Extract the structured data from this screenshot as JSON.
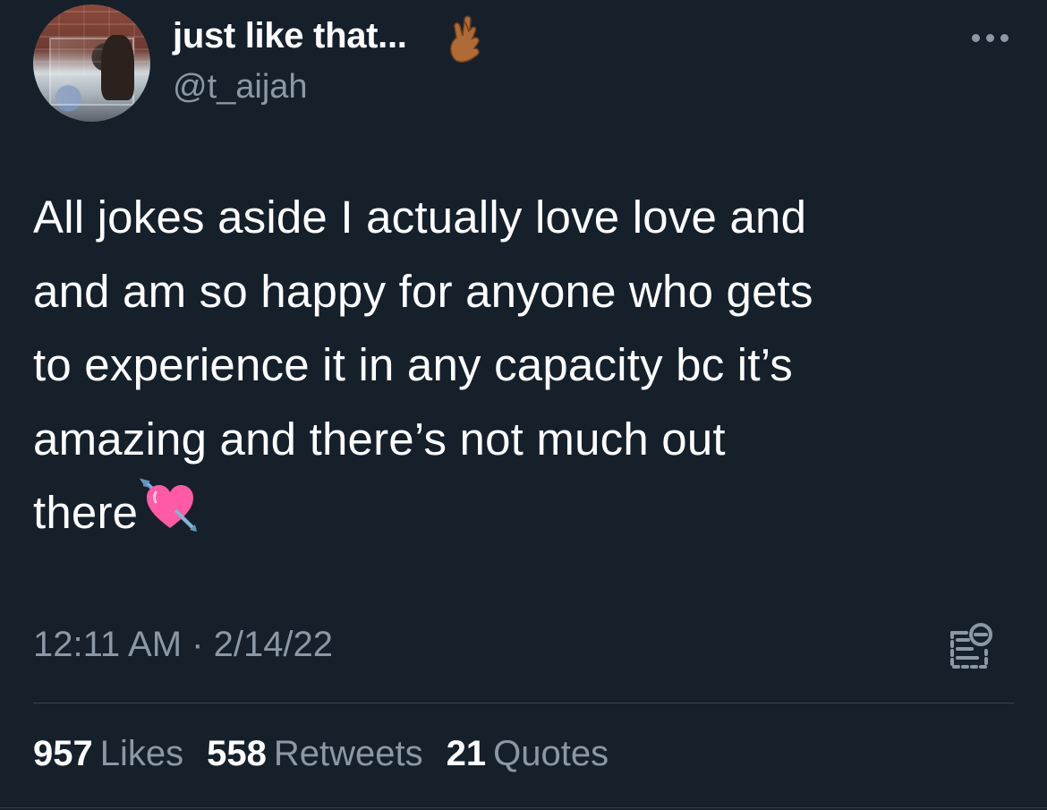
{
  "author": {
    "display_name": "just like that...",
    "handle": "@t_aijah",
    "display_name_emoji": "crossed-fingers-icon"
  },
  "tweet": {
    "lines": [
      "All jokes aside I actually love love and",
      "and am so happy for anyone who gets",
      "to experience it in any capacity bc it’s",
      "amazing and there’s not much out",
      "there"
    ],
    "trailing_emoji": "heart-with-arrow-icon",
    "timestamp": "12:11 AM · 2/14/22"
  },
  "stats": [
    {
      "count": "957",
      "label": "Likes"
    },
    {
      "count": "558",
      "label": "Retweets"
    },
    {
      "count": "21",
      "label": "Quotes"
    }
  ],
  "colors": {
    "background": "#15202b",
    "primary_text": "#ffffff",
    "secondary_text": "#8b98a5",
    "divider": "#38444d"
  }
}
